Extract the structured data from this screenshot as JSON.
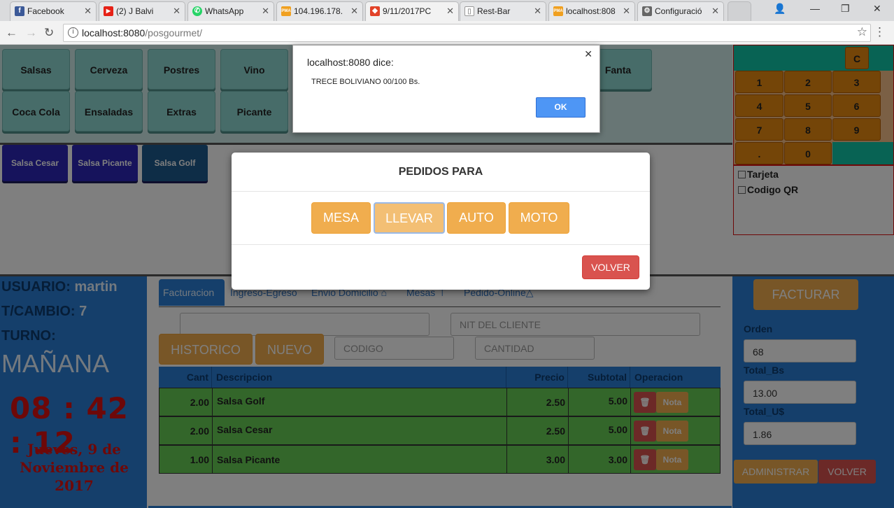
{
  "browser": {
    "tabs": [
      {
        "label": "Facebook",
        "icon": "f",
        "color": "#3b5998"
      },
      {
        "label": "(2) J Balvi",
        "icon": "▶",
        "color": "#e62117"
      },
      {
        "label": "WhatsApp",
        "icon": "✆",
        "color": "#25d366"
      },
      {
        "label": "104.196.178.",
        "icon": "PMA",
        "color": "#f0a020"
      },
      {
        "label": "9/11/2017PC",
        "icon": "◆",
        "color": "#e24329"
      },
      {
        "label": "Rest-Bar",
        "icon": "▯",
        "color": "#999999"
      },
      {
        "label": "localhost:808",
        "icon": "PMA",
        "color": "#f0a020"
      },
      {
        "label": "Configuració",
        "icon": "⚙",
        "color": "#666666"
      }
    ],
    "url_host": "localhost:8080",
    "url_path": "/posgourmet/"
  },
  "categories": [
    "Salsas",
    "Cerveza",
    "Postres",
    "Vino",
    "Fanta",
    "Coca Cola",
    "Ensaladas",
    "Extras",
    "Picante"
  ],
  "products": [
    {
      "label": "Salsa Cesar",
      "color": "#2c27b8"
    },
    {
      "label": "Salsa Picante",
      "color": "#2c27b8"
    },
    {
      "label": "Salsa Golf",
      "color": "#1d5a8e"
    }
  ],
  "keypad": {
    "clear": "C",
    "keys": [
      "1",
      "2",
      "3",
      "4",
      "5",
      "6",
      "7",
      "8",
      "9",
      ".",
      "0"
    ]
  },
  "payment_options": [
    "Tarjeta",
    "Codigo QR"
  ],
  "info": {
    "user_label": "USUARIO:",
    "user": "martin",
    "tc_label": "T/CAMBIO:",
    "tc": "7",
    "turno_label": "TURNO:",
    "turno": "MAÑANA",
    "clock": "08 : 42 : 12",
    "date": "Jueves, 9 de Noviembre de 2017"
  },
  "center": {
    "tabs": [
      "Facturacion",
      "Ingreso-Egreso",
      "Envio Domicilio",
      "Mesas",
      "Pedido-Online"
    ],
    "client_placeholder": "",
    "nit_placeholder": "NIT DEL CLIENTE",
    "historico": "HISTORICO",
    "nuevo": "NUEVO",
    "codigo_placeholder": "CODIGO",
    "cantidad_placeholder": "CANTIDAD",
    "table_headers": [
      "Cant",
      "Descripcion",
      "Precio",
      "Subtotal",
      "Operacion"
    ],
    "rows": [
      {
        "cant": "2.00",
        "desc": "Salsa Golf",
        "precio": "2.50",
        "subtotal": "5.00"
      },
      {
        "cant": "2.00",
        "desc": "Salsa Cesar",
        "precio": "2.50",
        "subtotal": "5.00"
      },
      {
        "cant": "1.00",
        "desc": "Salsa Picante",
        "precio": "3.00",
        "subtotal": "3.00"
      }
    ],
    "nota_label": "Nota"
  },
  "right": {
    "facturar": "FACTURAR",
    "orden_label": "Orden",
    "orden": "68",
    "total_bs_label": "Total_Bs",
    "total_bs": "13.00",
    "total_us_label": "Total_U$",
    "total_us": "1.86",
    "administrar": "ADMINISTRAR",
    "volver": "VOLVER"
  },
  "alert": {
    "title": "localhost:8080 dice:",
    "message": "TRECE BOLIVIANO 00/100 Bs.",
    "ok": "OK"
  },
  "modal": {
    "title": "PEDIDOS PARA",
    "options": [
      "MESA",
      "LLEVAR",
      "AUTO",
      "MOTO"
    ],
    "volver": "VOLVER"
  }
}
